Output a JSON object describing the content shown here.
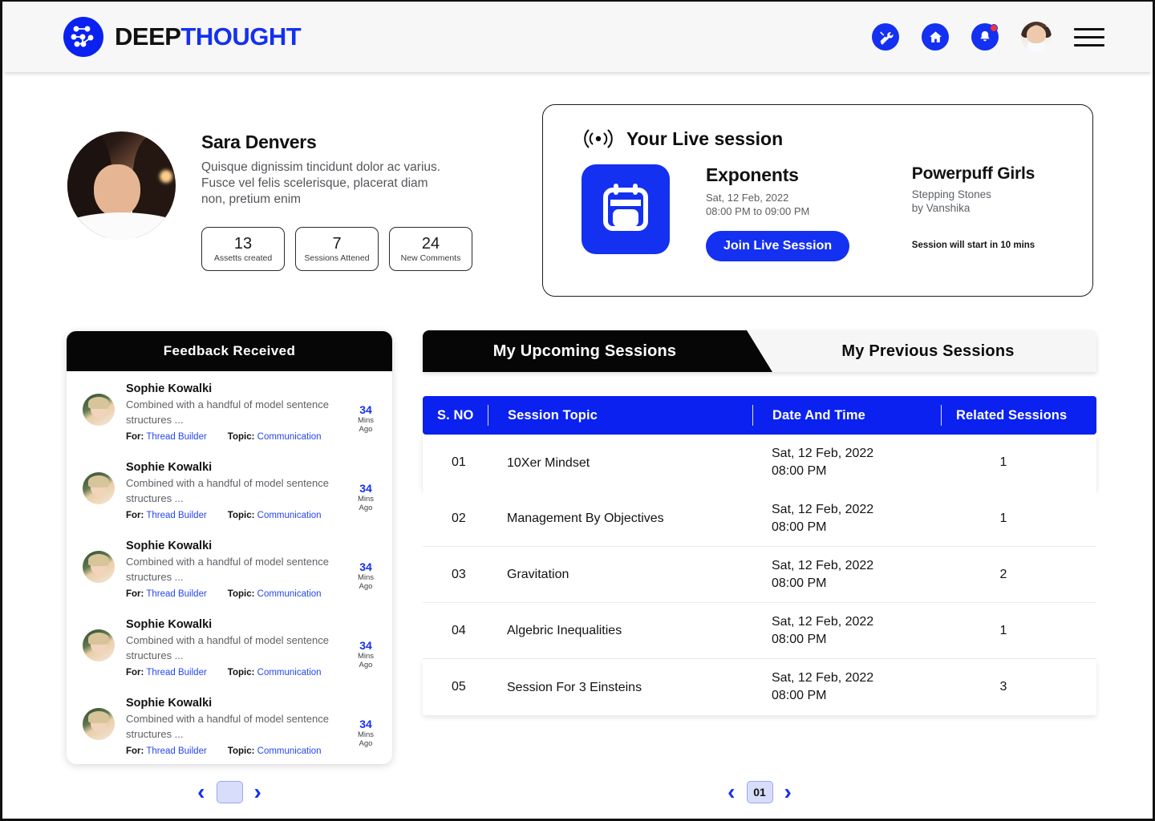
{
  "brand": {
    "part1": "DEEP",
    "part2": "THOUGHT",
    "logo_icon": "network-nodes-icon"
  },
  "header": {
    "icons": [
      {
        "name": "tools-icon",
        "label": "Tools"
      },
      {
        "name": "home-icon",
        "label": "Home"
      },
      {
        "name": "bell-icon",
        "label": "Notifications"
      }
    ],
    "avatar_label": "User avatar",
    "menu_label": "Menu"
  },
  "profile": {
    "name": "Sara Denvers",
    "bio": "Quisque dignissim tincidunt dolor ac varius. Fusce vel felis scelerisque, placerat diam non, pretium enim",
    "stats": [
      {
        "num": "13",
        "label": "Assetts created"
      },
      {
        "num": "7",
        "label": "Sessions Attened"
      },
      {
        "num": "24",
        "label": "New Comments"
      }
    ]
  },
  "live": {
    "icon": "broadcast-icon",
    "title": "Your Live session",
    "calendar_icon": "calendar-icon",
    "session_title": "Exponents",
    "session_date": "Sat, 12 Feb, 2022",
    "session_time": "08:00 PM to 09:00 PM",
    "join_label": "Join Live Session",
    "group_title": "Powerpuff Girls",
    "group_sub1": "Stepping Stones",
    "group_sub2": "by Vanshika",
    "start_note": "Session will start in 10 mins"
  },
  "feedback": {
    "heading": "Feedback Received",
    "items": [
      {
        "name": "Sophie Kowalki",
        "text": "Combined with a handful of model sentence structures ...",
        "for_label": "For:",
        "for_value": "Thread Builder",
        "topic_label": "Topic:",
        "topic_value": "Communication",
        "time_num": "34",
        "time_unit1": "Mins",
        "time_unit2": "Ago"
      },
      {
        "name": "Sophie Kowalki",
        "text": "Combined with a handful of model sentence structures ...",
        "for_label": "For:",
        "for_value": "Thread Builder",
        "topic_label": "Topic:",
        "topic_value": "Communication",
        "time_num": "34",
        "time_unit1": "Mins",
        "time_unit2": "Ago"
      },
      {
        "name": "Sophie Kowalki",
        "text": "Combined with a handful of model sentence structures ...",
        "for_label": "For:",
        "for_value": "Thread Builder",
        "topic_label": "Topic:",
        "topic_value": "Communication",
        "time_num": "34",
        "time_unit1": "Mins",
        "time_unit2": "Ago"
      },
      {
        "name": "Sophie Kowalki",
        "text": "Combined with a handful of model sentence structures ...",
        "for_label": "For:",
        "for_value": "Thread Builder",
        "topic_label": "Topic:",
        "topic_value": "Communication",
        "time_num": "34",
        "time_unit1": "Mins",
        "time_unit2": "Ago"
      },
      {
        "name": "Sophie Kowalki",
        "text": "Combined with a handful of model sentence structures ...",
        "for_label": "For:",
        "for_value": "Thread Builder",
        "topic_label": "Topic:",
        "topic_value": "Communication",
        "time_num": "34",
        "time_unit1": "Mins",
        "time_unit2": "Ago"
      }
    ],
    "pager": {
      "prev": "‹",
      "page": "",
      "next": "›"
    }
  },
  "sessions": {
    "tab_active": "My Upcoming Sessions",
    "tab_inactive": "My Previous Sessions",
    "columns": [
      "S. NO",
      "Session Topic",
      "Date And Time",
      "Related Sessions"
    ],
    "rows": [
      {
        "no": "01",
        "topic": "10Xer Mindset",
        "date": "Sat, 12 Feb, 2022",
        "time": "08:00 PM",
        "related": "1"
      },
      {
        "no": "02",
        "topic": "Management By Objectives",
        "date": "Sat, 12 Feb, 2022",
        "time": "08:00 PM",
        "related": "1"
      },
      {
        "no": "03",
        "topic": "Gravitation",
        "date": "Sat, 12 Feb, 2022",
        "time": "08:00 PM",
        "related": "2"
      },
      {
        "no": "04",
        "topic": "Algebric Inequalities",
        "date": "Sat, 12 Feb, 2022",
        "time": "08:00 PM",
        "related": "1"
      },
      {
        "no": "05",
        "topic": "Session For 3 Einsteins",
        "date": "Sat, 12 Feb, 2022",
        "time": "08:00 PM",
        "related": "3"
      }
    ],
    "pager": {
      "prev": "‹",
      "page": "01",
      "next": "›"
    }
  },
  "colors": {
    "accent": "#1430f0",
    "table_header": "#0a21f0",
    "dark": "#060606",
    "badge": "#f6323a"
  }
}
